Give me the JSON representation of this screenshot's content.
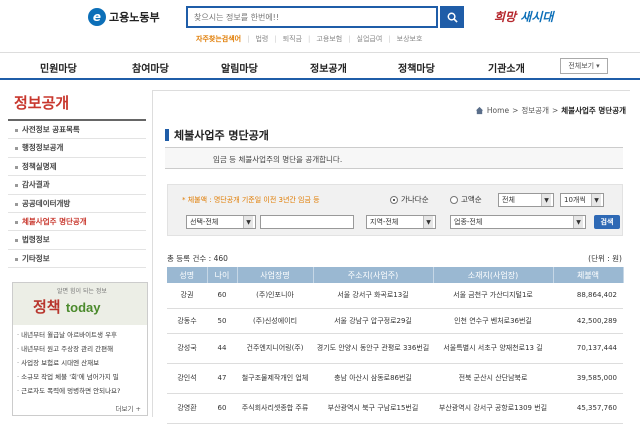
{
  "header": {
    "logo_text": "고용노동부",
    "search_placeholder": "찾으시는 정보를 한번에!!",
    "slogan_a": "희망",
    "slogan_b": "새시대",
    "quick_links": [
      "자주찾는검색어",
      "법령",
      "퇴직금",
      "고용보험",
      "실업급여",
      "보상보호"
    ]
  },
  "gnb": {
    "items": [
      "민원마당",
      "참여마당",
      "알림마당",
      "정보공개",
      "정책마당",
      "기관소개"
    ],
    "all_menu": "전체보기"
  },
  "sidebar": {
    "title": "정보공개",
    "items": [
      "사전정보 공표목록",
      "행정정보공개",
      "정책실명제",
      "감사결과",
      "공공데이터개방",
      "체불사업주 명단공개",
      "법령정보",
      "기타정보"
    ],
    "active": "체불사업주 명단공개"
  },
  "today": {
    "tag": "알면 힘이 되는 정보",
    "logo": "정책",
    "logo_sub": "today",
    "items": [
      "내년부터 월급날 아르바이트생 우후",
      "내년부터 원고 주상장 관리 간편해",
      "사업장 보험료 시대엔 산재보",
      "소규모 작업 체불 '회'에 넘어가지 밀",
      "근로자도 폭력에 멍병하면 안되나요?"
    ],
    "more": "더보기 +"
  },
  "breadcrumb": {
    "home": "Home",
    "level1": "정보공개",
    "current": "체불사업주 명단공개"
  },
  "page": {
    "title": "체불사업주 명단공개",
    "description": "임금 등 체불사업주의 명단을 공개합니다."
  },
  "filter": {
    "note": "* 체불액 : 명단공개 기준일 이전 3년간 임금 등",
    "radio_a": "가나다순",
    "radio_b": "고액순",
    "sel_order": "전체",
    "sel_count": "10개씩",
    "sel_scope": "선택-전체",
    "sel_region": "지역-전체",
    "sel_industry": "업종-전체",
    "search_btn": "검색"
  },
  "table": {
    "total_label": "총 등록 건수 : 460",
    "unit_label": "(단위 : 원)",
    "columns": [
      "성명",
      "나이",
      "사업장명",
      "주소지(사업주)",
      "소재지(사업장)",
      "체불액"
    ],
    "rows": [
      [
        "강권",
        "60",
        "(주)인포니아",
        "서울 강서구 화곡로13길",
        "서울 금천구 가산디지털1로",
        "88,864,402"
      ],
      [
        "강동수",
        "50",
        "(주)신성에이티",
        "서울 강남구 압구정로29길",
        "인천 연수구 벤처로36번길",
        "42,500,289"
      ],
      [
        "강성국",
        "44",
        "건주엔지니어링(주)",
        "경기도 안양시 동안구 관평로 336번길",
        "서울특별시 서초구 양재천로13 길",
        "70,137,444"
      ],
      [
        "강인석",
        "47",
        "철구조물제작개인 업체",
        "충남 아산시 삼동로86번길",
        "전북 군산시 산단남북로",
        "39,585,000"
      ],
      [
        "강영환",
        "60",
        "주식회사리셋종합 주류",
        "부산광역시 북구 구남로15번길",
        "부산광역시 강서구 공항로1309 번길",
        "45,357,760"
      ]
    ]
  }
}
